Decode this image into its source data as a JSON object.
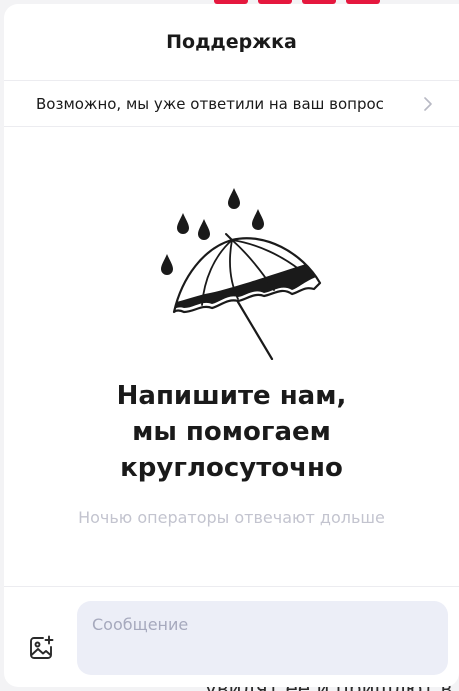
{
  "header": {
    "title": "Поддержка"
  },
  "faq": {
    "label": "Возможно, мы уже ответили на ваш вопрос"
  },
  "empty_state": {
    "title_lines": [
      "Напишите нам,",
      "мы помогаем",
      "круглосуточно"
    ],
    "subtitle": "Ночью операторы отвечают дольше"
  },
  "composer": {
    "placeholder": "Сообщение"
  },
  "background": {
    "partial_text": "увидят ее и пришлют в"
  },
  "colors": {
    "accent_red": "#e5183e",
    "input_bg": "#eceef7",
    "muted_text": "#c3c4cf"
  }
}
